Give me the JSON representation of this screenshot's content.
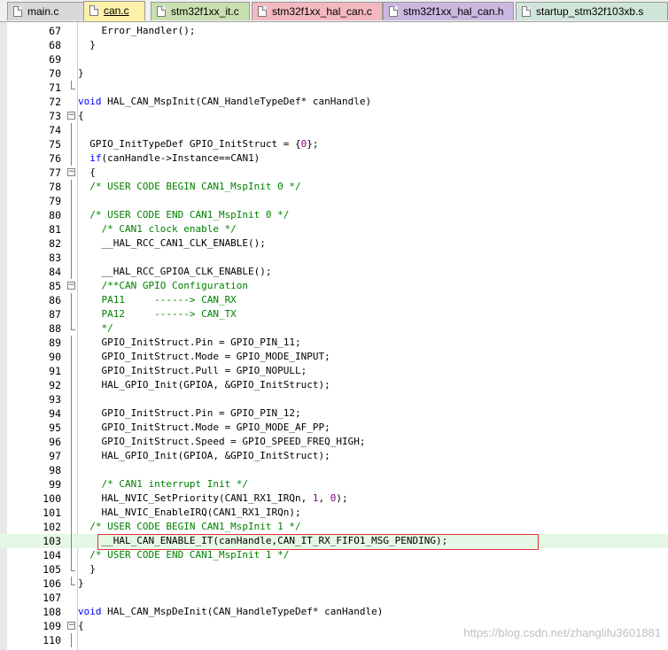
{
  "tabs": [
    {
      "label": "main.c",
      "bg": "#d8d8d8"
    },
    {
      "label": "can.c",
      "bg": "#fdf0a8",
      "active": true
    },
    {
      "label": "stm32f1xx_it.c",
      "bg": "#c9dfb0"
    },
    {
      "label": "stm32f1xx_hal_can.c",
      "bg": "#f4b8c0"
    },
    {
      "label": "stm32f1xx_hal_can.h",
      "bg": "#cbb8e0"
    },
    {
      "label": "startup_stm32f103xb.s",
      "bg": "#cfe5d9"
    }
  ],
  "colors": {
    "keyword": "#0000ff",
    "comment": "#008000",
    "number": "#800080",
    "highlight_line": "#e5f8e5",
    "annotation_box": "#e03030"
  },
  "lines": [
    {
      "n": "67",
      "fold": "",
      "segs": [
        [
          "    Error_Handler();",
          ""
        ]
      ]
    },
    {
      "n": "68",
      "fold": "",
      "segs": [
        [
          "  }",
          ""
        ]
      ]
    },
    {
      "n": "69",
      "fold": "",
      "segs": []
    },
    {
      "n": "70",
      "fold": "",
      "segs": [
        [
          "}",
          ""
        ]
      ]
    },
    {
      "n": "71",
      "fold": "tick",
      "segs": []
    },
    {
      "n": "72",
      "fold": "",
      "segs": [
        [
          "void",
          "kw"
        ],
        [
          " HAL_CAN_MspInit(CAN_HandleTypeDef* canHandle)",
          ""
        ]
      ]
    },
    {
      "n": "73",
      "fold": "box",
      "segs": [
        [
          "{",
          ""
        ]
      ]
    },
    {
      "n": "74",
      "fold": "vline",
      "segs": []
    },
    {
      "n": "75",
      "fold": "vline",
      "segs": [
        [
          "  GPIO_InitTypeDef GPIO_InitStruct = {",
          ""
        ],
        [
          "0",
          "num"
        ],
        [
          "};",
          ""
        ]
      ]
    },
    {
      "n": "76",
      "fold": "vline",
      "segs": [
        [
          "  ",
          ""
        ],
        [
          "if",
          "kw"
        ],
        [
          "(canHandle->Instance==CAN1)",
          ""
        ]
      ]
    },
    {
      "n": "77",
      "fold": "box",
      "segs": [
        [
          "  {",
          ""
        ]
      ]
    },
    {
      "n": "78",
      "fold": "vline",
      "segs": [
        [
          "  /* USER CODE BEGIN CAN1_MspInit 0 */",
          "cm"
        ]
      ]
    },
    {
      "n": "79",
      "fold": "vline",
      "segs": []
    },
    {
      "n": "80",
      "fold": "vline",
      "segs": [
        [
          "  /* USER CODE END CAN1_MspInit 0 */",
          "cm"
        ]
      ]
    },
    {
      "n": "81",
      "fold": "vline",
      "segs": [
        [
          "    /* CAN1 clock enable */",
          "cm"
        ]
      ]
    },
    {
      "n": "82",
      "fold": "vline",
      "segs": [
        [
          "    __HAL_RCC_CAN1_CLK_ENABLE();",
          ""
        ]
      ]
    },
    {
      "n": "83",
      "fold": "vline",
      "segs": []
    },
    {
      "n": "84",
      "fold": "vline",
      "segs": [
        [
          "    __HAL_RCC_GPIOA_CLK_ENABLE();",
          ""
        ]
      ]
    },
    {
      "n": "85",
      "fold": "box",
      "segs": [
        [
          "    /**CAN GPIO Configuration",
          "cm"
        ]
      ]
    },
    {
      "n": "86",
      "fold": "vline",
      "segs": [
        [
          "    PA11     ------> CAN_RX",
          "cm"
        ]
      ]
    },
    {
      "n": "87",
      "fold": "vline",
      "segs": [
        [
          "    PA12     ------> CAN_TX",
          "cm"
        ]
      ]
    },
    {
      "n": "88",
      "fold": "tick",
      "segs": [
        [
          "    */",
          "cm"
        ]
      ]
    },
    {
      "n": "89",
      "fold": "vline",
      "segs": [
        [
          "    GPIO_InitStruct.Pin = GPIO_PIN_11;",
          ""
        ]
      ]
    },
    {
      "n": "90",
      "fold": "vline",
      "segs": [
        [
          "    GPIO_InitStruct.Mode = GPIO_MODE_INPUT;",
          ""
        ]
      ]
    },
    {
      "n": "91",
      "fold": "vline",
      "segs": [
        [
          "    GPIO_InitStruct.Pull = GPIO_NOPULL;",
          ""
        ]
      ]
    },
    {
      "n": "92",
      "fold": "vline",
      "segs": [
        [
          "    HAL_GPIO_Init(GPIOA, &GPIO_InitStruct);",
          ""
        ]
      ]
    },
    {
      "n": "93",
      "fold": "vline",
      "segs": []
    },
    {
      "n": "94",
      "fold": "vline",
      "segs": [
        [
          "    GPIO_InitStruct.Pin = GPIO_PIN_12;",
          ""
        ]
      ]
    },
    {
      "n": "95",
      "fold": "vline",
      "segs": [
        [
          "    GPIO_InitStruct.Mode = GPIO_MODE_AF_PP;",
          ""
        ]
      ]
    },
    {
      "n": "96",
      "fold": "vline",
      "segs": [
        [
          "    GPIO_InitStruct.Speed = GPIO_SPEED_FREQ_HIGH;",
          ""
        ]
      ]
    },
    {
      "n": "97",
      "fold": "vline",
      "segs": [
        [
          "    HAL_GPIO_Init(GPIOA, &GPIO_InitStruct);",
          ""
        ]
      ]
    },
    {
      "n": "98",
      "fold": "vline",
      "segs": []
    },
    {
      "n": "99",
      "fold": "vline",
      "segs": [
        [
          "    /* CAN1 interrupt Init */",
          "cm"
        ]
      ]
    },
    {
      "n": "100",
      "fold": "vline",
      "segs": [
        [
          "    HAL_NVIC_SetPriority(CAN1_RX1_IRQn, ",
          ""
        ],
        [
          "1",
          "num"
        ],
        [
          ", ",
          ""
        ],
        [
          "0",
          "num"
        ],
        [
          ");",
          ""
        ]
      ]
    },
    {
      "n": "101",
      "fold": "vline",
      "segs": [
        [
          "    HAL_NVIC_EnableIRQ(CAN1_RX1_IRQn);",
          ""
        ]
      ]
    },
    {
      "n": "102",
      "fold": "vline",
      "segs": [
        [
          "  /* USER CODE BEGIN CAN1_MspInit 1 */",
          "cm"
        ]
      ]
    },
    {
      "n": "103",
      "fold": "vline",
      "hl": true,
      "segs": [
        [
          "    __HAL_CAN_ENABLE_IT(canHandle,CAN_IT_RX_FIFO1_MSG_PENDING);",
          ""
        ]
      ]
    },
    {
      "n": "104",
      "fold": "vline",
      "segs": [
        [
          "  /* USER CODE END CAN1_MspInit 1 */",
          "cm"
        ]
      ]
    },
    {
      "n": "105",
      "fold": "tick",
      "segs": [
        [
          "  }",
          ""
        ]
      ]
    },
    {
      "n": "106",
      "fold": "tick",
      "segs": [
        [
          "}",
          ""
        ]
      ]
    },
    {
      "n": "107",
      "fold": "",
      "segs": []
    },
    {
      "n": "108",
      "fold": "",
      "segs": [
        [
          "void",
          "kw"
        ],
        [
          " HAL_CAN_MspDeInit(CAN_HandleTypeDef* canHandle)",
          ""
        ]
      ]
    },
    {
      "n": "109",
      "fold": "box",
      "segs": [
        [
          "{",
          ""
        ]
      ]
    },
    {
      "n": "110",
      "fold": "vline",
      "segs": []
    }
  ],
  "watermark": "https://blog.csdn.net/zhanglifu3601881"
}
